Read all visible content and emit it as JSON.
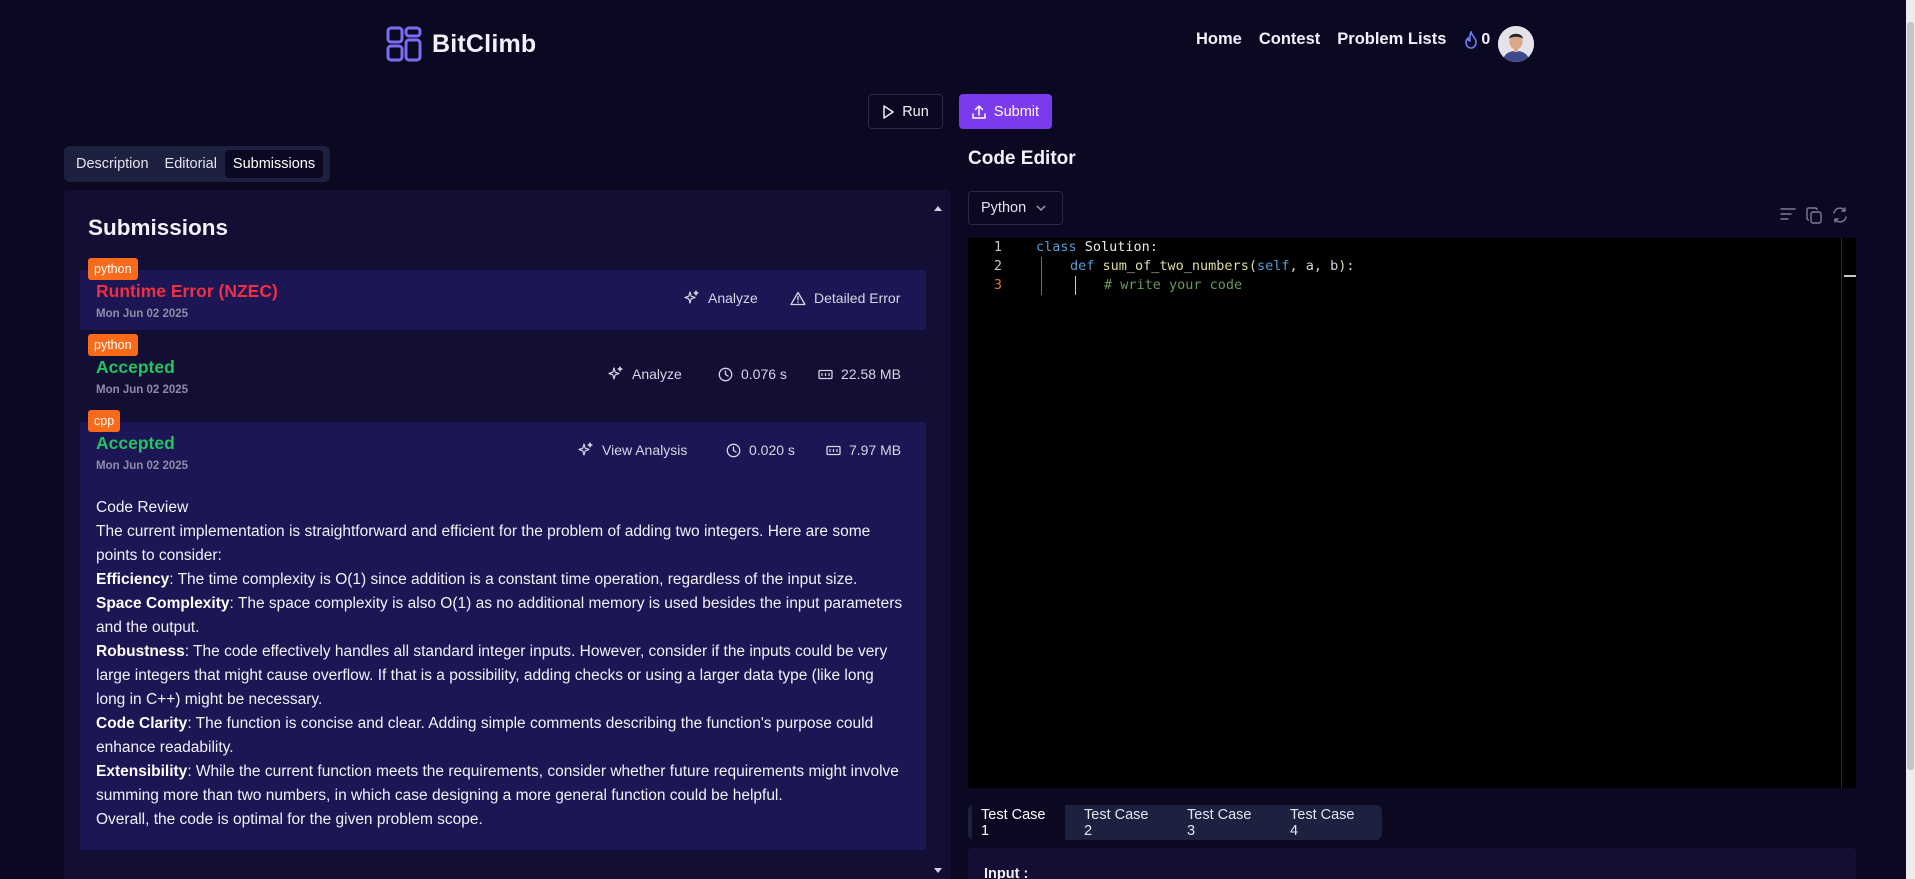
{
  "header": {
    "brand": "BitClimb",
    "nav": [
      "Home",
      "Contest",
      "Problem Lists"
    ],
    "streak": "0"
  },
  "actions": {
    "run": "Run",
    "submit": "Submit"
  },
  "left_tabs": [
    "Description",
    "Editorial",
    "Submissions"
  ],
  "submissions": {
    "title": "Submissions",
    "items": [
      {
        "lang": "python",
        "status": "Runtime Error (NZEC)",
        "date": "Mon Jun 02 2025",
        "analyze": "Analyze",
        "detail": "Detailed Error"
      },
      {
        "lang": "python",
        "status": "Accepted",
        "date": "Mon Jun 02 2025",
        "analyze": "Analyze",
        "time": "0.076 s",
        "memory": "22.58 MB"
      },
      {
        "lang": "cpp",
        "status": "Accepted",
        "date": "Mon Jun 02 2025",
        "analyze": "View Analysis",
        "time": "0.020 s",
        "memory": "7.97 MB"
      }
    ],
    "review": {
      "heading": "Code Review",
      "intro": "The current implementation is straightforward and efficient for the problem of adding two integers. Here are some points to consider:",
      "points": [
        {
          "label": "Efficiency",
          "text": ": The time complexity is O(1) since addition is a constant time operation, regardless of the input size."
        },
        {
          "label": "Space Complexity",
          "text": ": The space complexity is also O(1) as no additional memory is used besides the input parameters and the output."
        },
        {
          "label": "Robustness",
          "text": ": The code effectively handles all standard integer inputs. However, consider if the inputs could be very large integers that might cause overflow. If that is a possibility, adding checks or using a larger data type (like long long in C++) might be necessary."
        },
        {
          "label": "Code Clarity",
          "text": ": The function is concise and clear. Adding simple comments describing the function's purpose could enhance readability."
        },
        {
          "label": "Extensibility",
          "text": ": While the current function meets the requirements, consider whether future requirements might involve summing more than two numbers, in which case designing a more general function could be helpful."
        }
      ],
      "conclusion": "Overall, the code is optimal for the given problem scope."
    }
  },
  "editor": {
    "title": "Code Editor",
    "language": "Python",
    "line_numbers": [
      "1",
      "2",
      "3"
    ],
    "code": {
      "l1_kw": "class",
      "l1_name": " Solution",
      "l1_end": ":",
      "l2_kw": "def",
      "l2_fn": " sum_of_two_numbers",
      "l2_open": "(",
      "l2_self": "self",
      "l2_args": ", a, b",
      "l2_close": "):",
      "l3_comment": "# write your code"
    }
  },
  "test_tabs": [
    "Test Case 1",
    "Test Case 2",
    "Test Case 3",
    "Test Case 4"
  ],
  "test_input_label": "Input :"
}
